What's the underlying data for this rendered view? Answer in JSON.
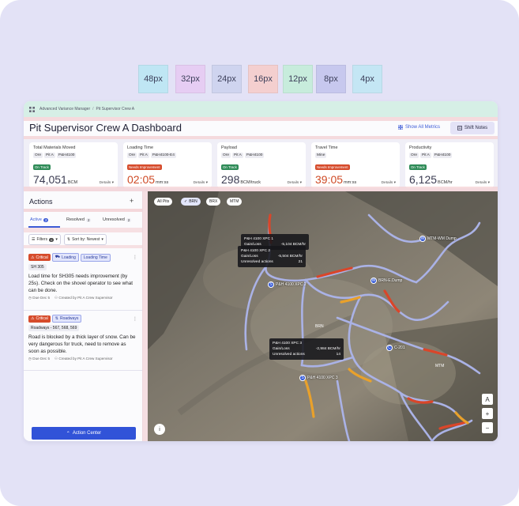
{
  "spacing_legend": [
    {
      "label": "48px",
      "color": "#bfe6f4"
    },
    {
      "label": "32px",
      "color": "#e6cdf3"
    },
    {
      "label": "24px",
      "color": "#cfd4ef"
    },
    {
      "label": "16px",
      "color": "#f4cfcf"
    },
    {
      "label": "12px",
      "color": "#c7ecdc"
    },
    {
      "label": "8px",
      "color": "#c7c8ee"
    },
    {
      "label": "4px",
      "color": "#c4e6f4"
    }
  ],
  "breadcrumb": {
    "root": "Advanced Variance Manager",
    "separator": "/",
    "current": "Pit Supervisor Crew A"
  },
  "header": {
    "title": "Pit Supervisor Crew A Dashboard",
    "show_all_metrics": "Show All Metrics",
    "shift_notes": "Shift Notes"
  },
  "metrics": [
    {
      "title": "Total Materials Moved",
      "tags": [
        "Ore",
        "Pit A",
        "P&H4100"
      ],
      "status": "On Track",
      "status_type": "ok",
      "value": "74,051",
      "unit": "BCM",
      "details": "Details"
    },
    {
      "title": "Loading Time",
      "tags": [
        "Ore",
        "Pit A",
        "P&H4100-E4"
      ],
      "status": "Needs Improvement",
      "status_type": "bad",
      "value": "02:05",
      "unit": "mm:ss",
      "details": "Details"
    },
    {
      "title": "Payload",
      "tags": [
        "Ore",
        "Pit A",
        "P&H4100"
      ],
      "status": "On Track",
      "status_type": "ok",
      "value": "298",
      "unit": "BCM/truck",
      "details": "Details"
    },
    {
      "title": "Travel Time",
      "tags": [
        "Mine"
      ],
      "status": "Needs Improvement",
      "status_type": "bad",
      "value": "39:05",
      "unit": "mm:ss",
      "details": "Details"
    },
    {
      "title": "Productivity",
      "tags": [
        "Ore",
        "Pit A",
        "P&H4100"
      ],
      "status": "On Track",
      "status_type": "ok",
      "value": "6,125",
      "unit": "BCM/hr",
      "details": "Details"
    }
  ],
  "actions": {
    "title": "Actions",
    "tabs": [
      {
        "label": "Active",
        "count": "2"
      },
      {
        "label": "Resolved",
        "count": "2"
      },
      {
        "label": "Unresolved",
        "count": "2"
      }
    ],
    "filters_label": "Filters",
    "filters_count": "0",
    "sort_label": "Sort by: Newest",
    "cards": [
      {
        "severity": "Critical",
        "tags": [
          "Loading",
          "Loading Time"
        ],
        "subject": "SH 305",
        "text": "Load time for SH305 needs improvement (by 25s). Check on the shovel operator to see what can be done.",
        "due": "Due Dec 5",
        "created": "Created by Pit A Crew Supervisor"
      },
      {
        "severity": "Critical",
        "tags": [
          "Roadways"
        ],
        "subject": "Roadways - 567, 568, 569",
        "text": "Road is blocked by a thick layer of snow. Can be very dangerous for truck, need to remove as soon as possible.",
        "due": "Due Dec 5",
        "created": "Created by Pit A Crew Supervisor"
      }
    ],
    "action_center": "Action Center"
  },
  "map": {
    "pit_filters": [
      {
        "label": "All Pits",
        "selected": false
      },
      {
        "label": "BRN",
        "selected": true
      },
      {
        "label": "BRX",
        "selected": false
      },
      {
        "label": "MTM",
        "selected": false
      }
    ],
    "popups": [
      {
        "title": "P&H 4100 XPC 1",
        "rows": [
          [
            "Gain/Loss",
            "-5,104 BCM/hr"
          ]
        ]
      },
      {
        "title": "P&H 4100 XPC 2",
        "rows": [
          [
            "Gain/Loss",
            "-5,504 BCM/hr"
          ],
          [
            "Unresolved actions",
            "21"
          ]
        ]
      },
      {
        "title": "P&H 4100 XPC 3",
        "rows": [
          [
            "Gain/Loss",
            "-2,984 BCM/hr"
          ],
          [
            "Unresolved actions",
            "14"
          ]
        ]
      }
    ],
    "markers": [
      {
        "icon": "S",
        "label": "P&H 4100 XPC 2"
      },
      {
        "icon": "S",
        "label": "P&H 4100 XPC 3"
      },
      {
        "icon": "W",
        "label": "MTM-WM Dump"
      },
      {
        "icon": "W",
        "label": "BRN-E.Dump"
      },
      {
        "icon": "C",
        "label": "C-201"
      }
    ],
    "area_labels": [
      "BRN",
      "MTM"
    ],
    "zoom_controls": [
      "A",
      "+",
      "−"
    ],
    "info_icon": "i"
  }
}
